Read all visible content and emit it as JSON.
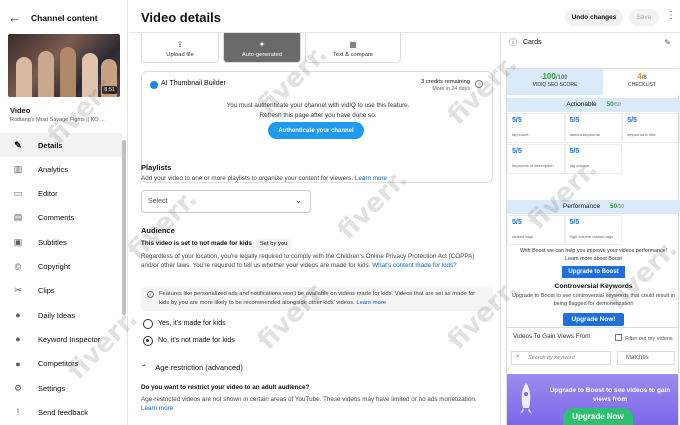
{
  "sidebar": {
    "header": "Channel content",
    "thumbnail_duration": "8:51",
    "video_label": "Video",
    "video_title": "Rodtang's Most Savage Fights || KO ...",
    "items": [
      {
        "label": "Details",
        "icon": "pencil-icon",
        "glyph": "✎"
      },
      {
        "label": "Analytics",
        "icon": "analytics-icon",
        "glyph": "▥"
      },
      {
        "label": "Editor",
        "icon": "editor-icon",
        "glyph": "▭"
      },
      {
        "label": "Comments",
        "icon": "comments-icon",
        "glyph": "▤"
      },
      {
        "label": "Subtitles",
        "icon": "subtitles-icon",
        "glyph": "▣"
      },
      {
        "label": "Copyright",
        "icon": "copyright-icon",
        "glyph": "©"
      },
      {
        "label": "Clips",
        "icon": "scissors-icon",
        "glyph": "✂"
      },
      {
        "label": "Daily Ideas",
        "icon": "ideas-icon",
        "glyph": "●"
      },
      {
        "label": "Keyword Inspector",
        "icon": "keyword-icon",
        "glyph": "●"
      },
      {
        "label": "Competitors",
        "icon": "competitors-icon",
        "glyph": "●"
      },
      {
        "label": "Settings",
        "icon": "gear-icon",
        "glyph": "⚙"
      },
      {
        "label": "Send feedback",
        "icon": "feedback-icon",
        "glyph": "!"
      }
    ]
  },
  "header": {
    "title": "Video details",
    "undo_label": "Undo changes",
    "save_label": "Save"
  },
  "thumbnail_options": [
    "Upload file",
    "Auto-generated",
    "Text & compare"
  ],
  "vidiq": {
    "title": "AI Thumbnail Builder",
    "credits": "3 credits remaining",
    "credits_reset": "More in 24 days",
    "message_line1": "You must authenticate your channel with vidIQ to use this feature.",
    "message_line2": "Refresh this page after you have done so.",
    "auth_button": "Authenticate your channel"
  },
  "playlists": {
    "heading": "Playlists",
    "desc": "Add your video to one or more playlists to organize your content for viewers.",
    "learn_more": "Learn more",
    "select_value": "Select"
  },
  "audience": {
    "heading": "Audience",
    "status": "This video is set to not made for kids",
    "set_by": "Set by you",
    "desc": "Regardless of your location, you're legally required to comply with the Children's Online Privacy Protection Act (COPPA) and/or other laws. You're required to tell us whether your videos are made for kids.",
    "desc_link": "What's content made for kids?",
    "note": "Features like personalized ads and notifications won't be available on videos made for kids. Videos that are set as made for kids by you are more likely to be recommended alongside other kids' videos.",
    "note_link": "Learn more",
    "option_yes": "Yes, it's made for kids",
    "option_no": "No, it's not made for kids",
    "selected": "no"
  },
  "age": {
    "heading": "Age restriction (advanced)",
    "question": "Do you want to restrict your video to an adult audience?",
    "desc": "Age-restricted videos are not shown in certain areas of YouTube. These videos may have limited or no ads monetization.",
    "link": "Learn more"
  },
  "right": {
    "cards_label": "Cards",
    "seo_score": "100",
    "seo_score_max": "/100",
    "seo_label": "VIDIQ SEO SCORE",
    "checklist_score": "4",
    "checklist_max": "/8",
    "checklist_label": "CHECKLIST",
    "actionable_label": "Actionable",
    "actionable_score": "50",
    "actionable_max": "/50",
    "actionable_cells": [
      {
        "v": "5/5",
        "d": "tag count"
      },
      {
        "v": "5/5",
        "d": "ranked keywords"
      },
      {
        "v": "5/5",
        "d": "keywords in title"
      },
      {
        "v": "5/5",
        "d": "keywords in description"
      },
      {
        "v": "5/5",
        "d": "tag volume"
      }
    ],
    "performance_label": "Performance",
    "performance_score": "50",
    "performance_max": "/50",
    "performance_cells": [
      {
        "v": "5/5",
        "d": "ranked tags"
      },
      {
        "v": "5/5",
        "d": "high volume ranked tags"
      }
    ],
    "boost_text": "With Boost we can help you improve your videos performance!",
    "boost_link": "Learn more about Boost",
    "boost_button": "Upgrade to Boost",
    "controversial_title": "Controversial Keywords",
    "controversial_text": "Upgrade to Boost to see controversial keywords that could result in being flagged for demonetization",
    "controversial_button": "Upgrade Now!",
    "vtg_title": "Videos To Gain Views From",
    "filter_label": "Filter out my videos",
    "search_placeholder": "Search by keyword",
    "matches_label": "Matches",
    "promo_text": "Upgrade to Boost to see videos to gain views from",
    "promo_button": "Upgrade Now"
  },
  "watermark": "fiverr.",
  "colors": {
    "accent": "#065fd4",
    "vidiq_blue": "#1e9bf0",
    "score_green": "#2e9e36",
    "boost_blue": "#1e6fd9",
    "promo_purple": "#8b7bec",
    "promo_green": "#2fbf71"
  }
}
